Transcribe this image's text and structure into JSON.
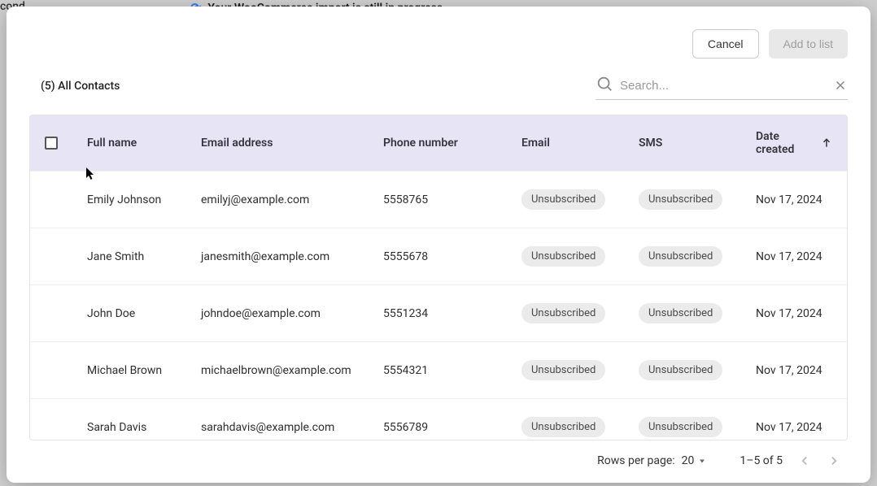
{
  "background": {
    "left_text": "cond",
    "banner_text": "Your WooCommerce import is still in progress."
  },
  "modal": {
    "buttons": {
      "cancel": "Cancel",
      "add_to_list": "Add to list"
    },
    "title": "(5) All Contacts",
    "search": {
      "placeholder": "Search..."
    },
    "columns": {
      "full_name": "Full name",
      "email_address": "Email address",
      "phone_number": "Phone number",
      "email": "Email",
      "sms": "SMS",
      "date_created": "Date created"
    },
    "rows": [
      {
        "name": "Emily Johnson",
        "email": "emilyj@example.com",
        "phone": "5558765",
        "email_status": "Unsubscribed",
        "sms_status": "Unsubscribed",
        "date": "Nov 17, 2024"
      },
      {
        "name": "Jane Smith",
        "email": "janesmith@example.com",
        "phone": "5555678",
        "email_status": "Unsubscribed",
        "sms_status": "Unsubscribed",
        "date": "Nov 17, 2024"
      },
      {
        "name": "John Doe",
        "email": "johndoe@example.com",
        "phone": "5551234",
        "email_status": "Unsubscribed",
        "sms_status": "Unsubscribed",
        "date": "Nov 17, 2024"
      },
      {
        "name": "Michael Brown",
        "email": "michaelbrown@example.com",
        "phone": "5554321",
        "email_status": "Unsubscribed",
        "sms_status": "Unsubscribed",
        "date": "Nov 17, 2024"
      },
      {
        "name": "Sarah Davis",
        "email": "sarahdavis@example.com",
        "phone": "5556789",
        "email_status": "Unsubscribed",
        "sms_status": "Unsubscribed",
        "date": "Nov 17, 2024"
      }
    ],
    "footer": {
      "rows_per_page_label": "Rows per page:",
      "rows_per_page_value": "20",
      "range": "1–5 of 5"
    }
  }
}
